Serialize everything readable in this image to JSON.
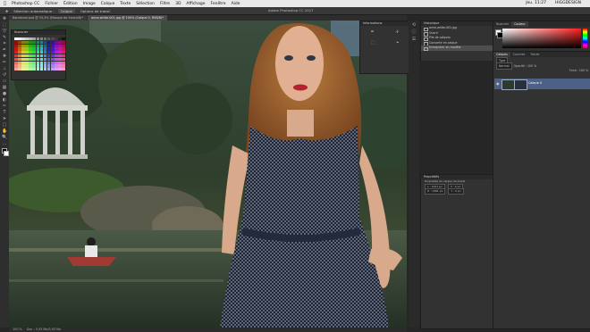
{
  "menubar": {
    "items": [
      "Photoshop CC",
      "Fichier",
      "Édition",
      "Image",
      "Calque",
      "Texte",
      "Sélection",
      "Filtre",
      "3D",
      "Affichage",
      "Fenêtre",
      "Aide"
    ],
    "clock": "Jeu. 11:27",
    "user": "HIGGDESIGN"
  },
  "app_title": "Adobe Photoshop CC 2017",
  "options": {
    "tool": "Sélection automatique :",
    "mode": "Calque",
    "transform": "Options de transf."
  },
  "document_tabs": [
    "Bandenoir.psd @ 33,3% (Masque de fusion/8)*",
    "anne-white-001.jpg @ 100% (Calque 0, RVB/8)*"
  ],
  "panels": {
    "swatches_title": "Nuancier",
    "info_title": "Informations",
    "history_title": "Historique",
    "history_items": [
      {
        "label": "anne-white-001.jpg",
        "selected": false
      },
      {
        "label": "Ouvrir",
        "selected": false
      },
      {
        "label": "Pile de calques",
        "selected": false
      },
      {
        "label": "Convertir en calque",
        "selected": false
      },
      {
        "label": "Enregistrer en modèle",
        "selected": true
      }
    ],
    "color_tabs": [
      "Nuancier",
      "Couleur"
    ],
    "layers_tabs": [
      "Calques",
      "Couches",
      "Tracés"
    ],
    "layers_filter": "Type",
    "layers_mode": "Normal",
    "opacity_label": "Opacité : 100 %",
    "fill_label": "Fond : 100 %",
    "layer_name": "Calque 0",
    "properties_title": "Propriétés",
    "properties_sub": "Propriétés du calque de pixels",
    "prop_w": "L : 1921 px",
    "prop_h": "H : 1081 px",
    "prop_x": "X : 0 px",
    "prop_y": "Y : 0 px"
  },
  "status": {
    "zoom": "100 %",
    "doc": "Doc : 5,93 Mo/5,93 Mo"
  },
  "colors": {
    "accent": "#4d6186",
    "panel": "#323232",
    "menubar": "#e9e9e9"
  }
}
